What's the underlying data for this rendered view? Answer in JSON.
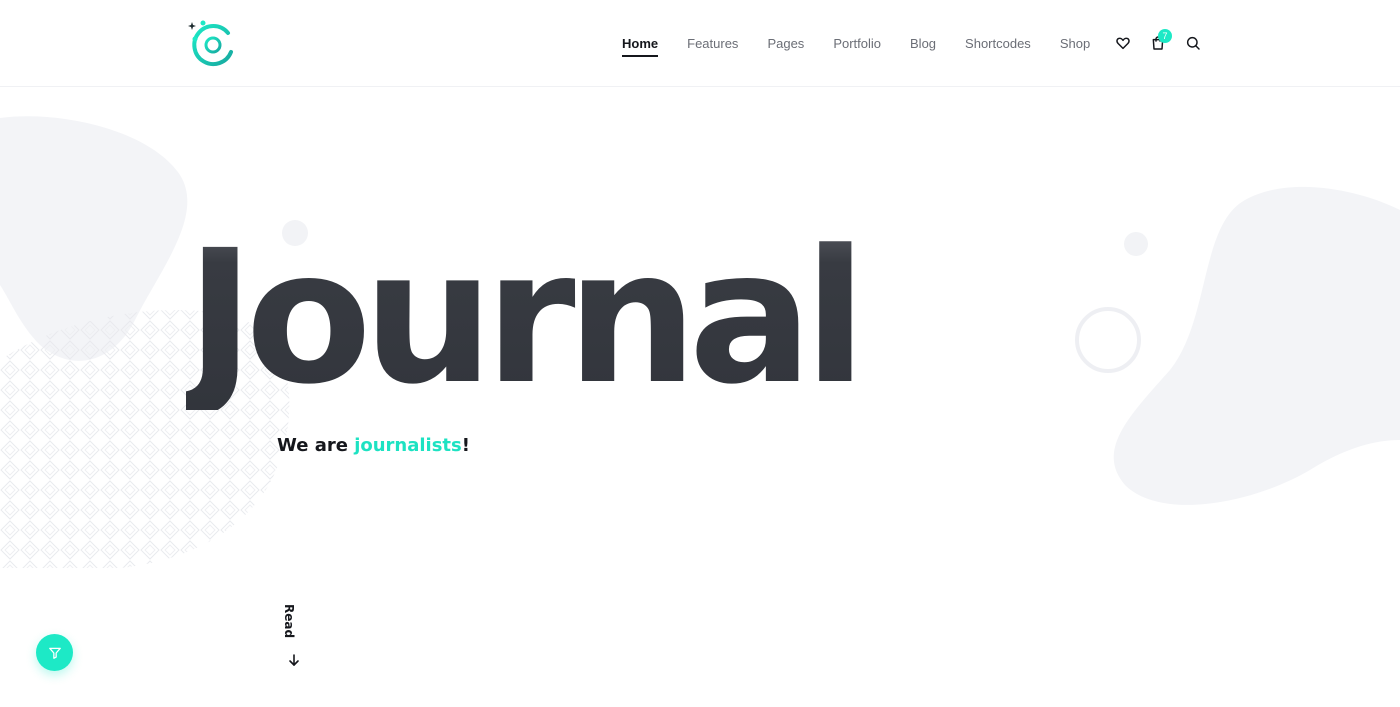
{
  "header": {
    "logo": {
      "icon": "g-circuit-logo-icon"
    },
    "nav": {
      "items": [
        {
          "label": "Home",
          "active": true
        },
        {
          "label": "Features",
          "active": false
        },
        {
          "label": "Pages",
          "active": false
        },
        {
          "label": "Portfolio",
          "active": false
        },
        {
          "label": "Blog",
          "active": false
        },
        {
          "label": "Shortcodes",
          "active": false
        },
        {
          "label": "Shop",
          "active": false
        }
      ]
    },
    "icons": {
      "wishlist": "heart-icon",
      "cart": "shopping-bag-icon",
      "search": "search-icon"
    },
    "cart_count": "7"
  },
  "hero": {
    "title": "Journal",
    "subtitle_prefix": "We are ",
    "subtitle_accent": "journalists",
    "subtitle_suffix": "!"
  },
  "read_more": {
    "label": "Read",
    "icon": "arrow-down-icon"
  },
  "filter_button": {
    "icon": "filter-funnel-icon"
  },
  "colors": {
    "accent": "#1de9c6",
    "title": "#383b42",
    "text_dark": "#15171c",
    "nav_text": "#6b6e76",
    "blob": "#f3f4f7"
  }
}
